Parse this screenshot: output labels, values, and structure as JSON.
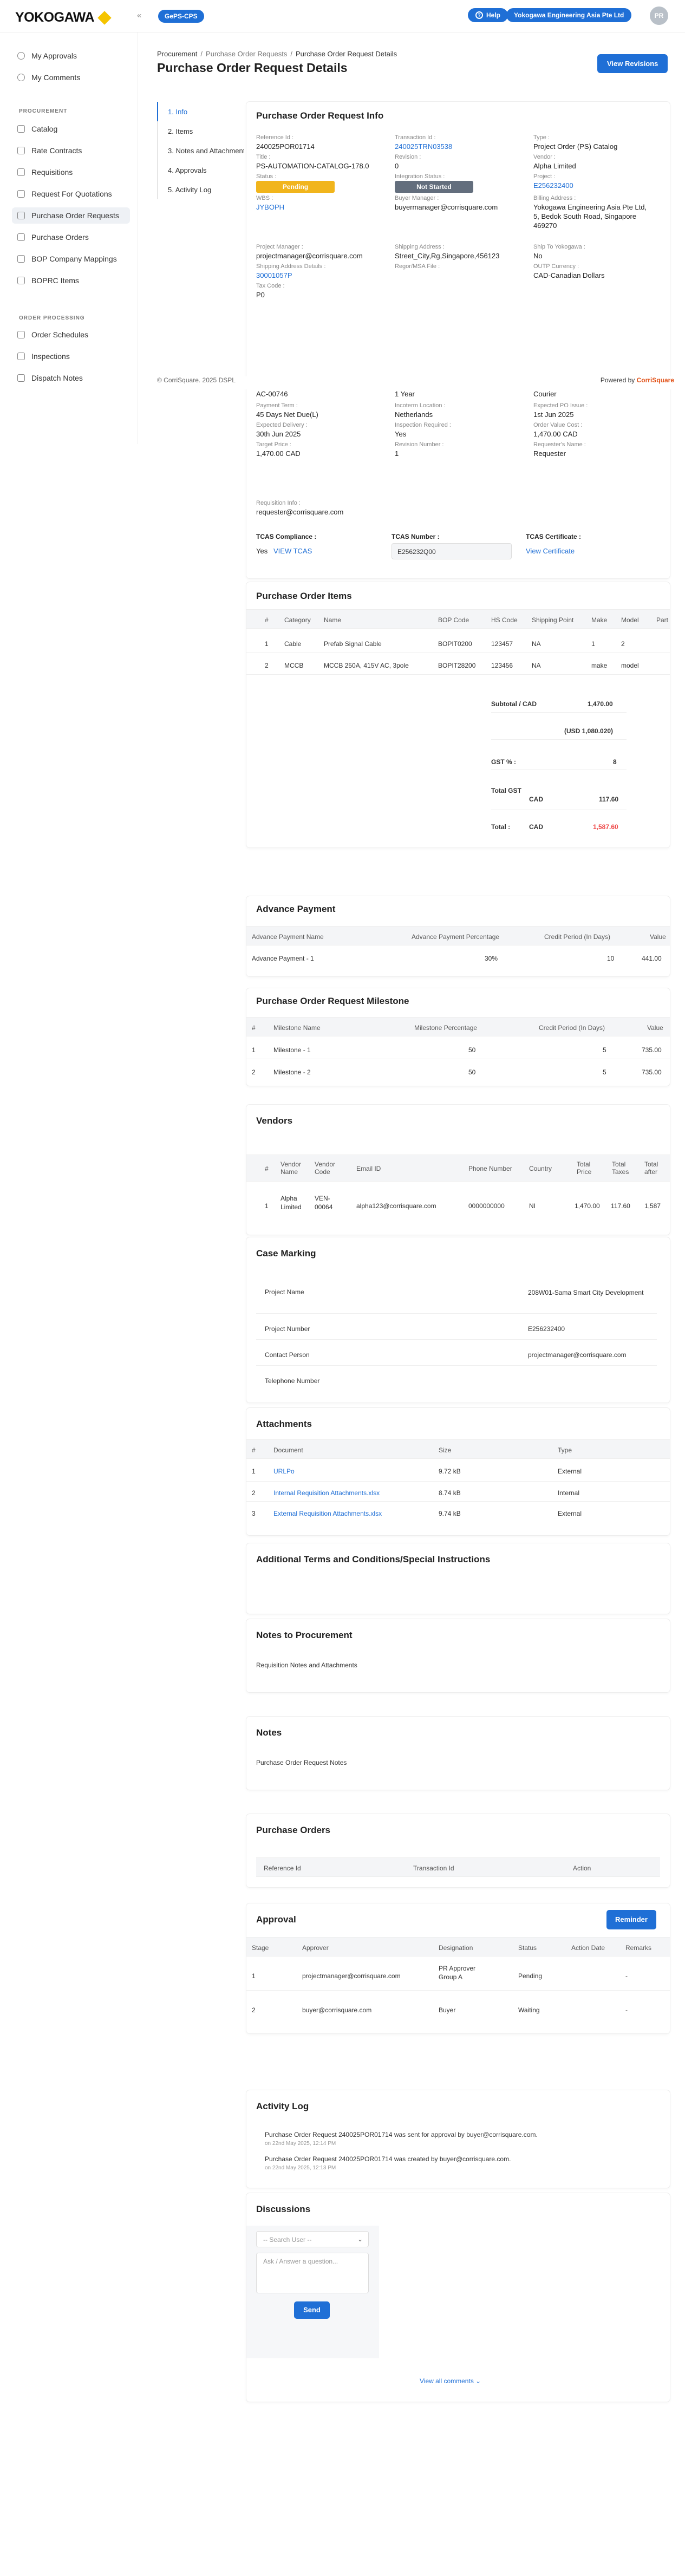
{
  "header": {
    "logo": "YOKOGAWA",
    "app_badge": "GePS-CPS",
    "help": "Help",
    "entity": "Yokogawa Engineering Asia Pte Ltd",
    "avatar": "PR"
  },
  "sidebar": {
    "top": [
      {
        "label": "My Approvals",
        "icon": "approvals-icon"
      },
      {
        "label": "My Comments",
        "icon": "comments-icon"
      }
    ],
    "section1": "PROCUREMENT",
    "procurement": [
      {
        "label": "Catalog"
      },
      {
        "label": "Rate Contracts"
      },
      {
        "label": "Requisitions"
      },
      {
        "label": "Request For Quotations"
      },
      {
        "label": "Purchase Order Requests"
      },
      {
        "label": "Purchase Orders"
      },
      {
        "label": "BOP Company Mappings"
      },
      {
        "label": "BOPRC Items"
      }
    ],
    "section2": "ORDER PROCESSING",
    "order": [
      {
        "label": "Order Schedules"
      },
      {
        "label": "Inspections"
      },
      {
        "label": "Dispatch Notes"
      }
    ]
  },
  "breadcrumb": [
    "Procurement",
    "/",
    "Purchase Order Requests",
    "/",
    "Purchase Order Request Details"
  ],
  "page_title": "Purchase Order Request Details",
  "view_revisions": "View Revisions",
  "nav": [
    "1. Info",
    "2. Items",
    "3. Notes and Attachments",
    "4. Approvals",
    "5. Activity Log"
  ],
  "footer": {
    "copyright": "© CorriSquare. 2025 DSPL",
    "powered": "Powered by",
    "brand": "CorriSquare"
  },
  "info": {
    "title": "Purchase Order Request Info",
    "fields": [
      {
        "label": "Reference Id :",
        "value": "240025POR01714"
      },
      {
        "label": "Transaction Id :",
        "value": "240025TRN03538",
        "link": true
      },
      {
        "label": "Type :",
        "value": "Project Order (PS) Catalog"
      },
      {
        "label": "Title :",
        "value": "PS-AUTOMATION-CATALOG-178.0"
      },
      {
        "label": "Revision :",
        "value": "0"
      },
      {
        "label": "Vendor :",
        "value": "Alpha Limited"
      },
      {
        "label": "WBS :",
        "value": "JYBOPH",
        "link": true
      },
      {
        "label": "Buyer Manager :",
        "value": "buyermanager@corrisquare.com"
      },
      {
        "label": "Billing Address :",
        "value": "Yokogawa Engineering Asia Pte Ltd, 5, Bedok South Road, Singapore 469270"
      },
      {
        "label": "Project Manager :",
        "value": "projectmanager@corrisquare.com"
      },
      {
        "label": "Shipping Address :",
        "value": "Street_City,Rg,Singapore,456123"
      },
      {
        "label": "Ship To Yokogawa :",
        "value": "No"
      },
      {
        "label": "Shipping Address Details :",
        "value": "30001057P",
        "link": true
      },
      {
        "label": "Regor/MSA File :",
        "value": ""
      },
      {
        "label": "OUTP Currency :",
        "value": "CAD-Canadian Dollars"
      },
      {
        "label": "Tax Code :",
        "value": "P0"
      },
      {
        "label": "INCOTERMS :",
        "value": "1 Year"
      },
      {
        "label": "Payment Term :",
        "value": "45 Days Net Due(L)"
      },
      {
        "label": "Incoterm Location :",
        "value": "Netherlands"
      },
      {
        "label": "Expected PO Issue :",
        "value": "1st Jun 2025"
      },
      {
        "label": "Expected Delivery :",
        "value": "30th Jun 2025"
      },
      {
        "label": "Inspection Required :",
        "value": "Yes"
      },
      {
        "label": "Order Value Cost :",
        "value": "1,470.00 CAD"
      },
      {
        "label": "Target Price :",
        "value": "1,470.00 CAD"
      },
      {
        "label": "Revision Number :",
        "value": "1"
      },
      {
        "label": "Requester's Name :",
        "value": "Requester"
      },
      {
        "label": "Requisition Info :",
        "value": "requester@corrisquare.com"
      }
    ],
    "status_label": "Status :",
    "status": "Pending",
    "integration_label": "Integration Status :",
    "integration": "Not Started",
    "project_label": "Project :",
    "project": "E256232400",
    "row_ac": "AC-00746",
    "row_courier": "Courier",
    "tcas_compliance_label": "TCAS Compliance :",
    "tcas_compliance": "Yes",
    "view_tcas": "VIEW TCAS",
    "tcas_number_label": "TCAS Number :",
    "tcas_number": "E256232Q00",
    "tcas_cert_label": "TCAS Certificate :",
    "view_cert": "View Certificate"
  },
  "items": {
    "title": "Purchase Order Items",
    "headers": [
      "#",
      "Category",
      "Name",
      "BOP Code",
      "HS Code",
      "Shipping Point",
      "Make",
      "Model",
      "Part"
    ],
    "rows": [
      [
        "1",
        "Cable",
        "Prefab Signal Cable",
        "BOPIT0200",
        "123457",
        "NA",
        "1",
        "2",
        ""
      ],
      [
        "2",
        "MCCB",
        "MCCB 250A, 415V AC, 3pole",
        "BOPIT28200",
        "123456",
        "NA",
        "make",
        "model",
        ""
      ]
    ],
    "subtotal_label": "Subtotal / CAD",
    "subtotal": "1,470.00",
    "usd": "(USD 1,080.020)",
    "gst_label": "GST % :",
    "gst": "8",
    "total_gst_label": "Total GST",
    "gst_cad": "CAD",
    "total_gst": "117.60",
    "total_label": "Total :",
    "total_cad": "CAD",
    "total": "1,587.60"
  },
  "advance": {
    "title": "Advance Payment",
    "headers": [
      "Advance Payment Name",
      "Advance Payment Percentage",
      "Credit Period (In Days)",
      "Value"
    ],
    "rows": [
      [
        "Advance Payment - 1",
        "30%",
        "10",
        "441.00"
      ]
    ]
  },
  "milestone": {
    "title": "Purchase Order Request Milestone",
    "headers": [
      "#",
      "Milestone Name",
      "Milestone Percentage",
      "Credit Period (In Days)",
      "Value"
    ],
    "rows": [
      [
        "1",
        "Milestone - 1",
        "50",
        "5",
        "735.00"
      ],
      [
        "2",
        "Milestone - 2",
        "50",
        "5",
        "735.00"
      ]
    ]
  },
  "vendors": {
    "title": "Vendors",
    "headers": [
      "#",
      "Vendor Name",
      "Vendor Code",
      "Email ID",
      "Phone Number",
      "Country",
      "Total Price",
      "Total Taxes",
      "Total after"
    ],
    "rows": [
      [
        "1",
        "Alpha Limited",
        "VEN-00064",
        "alpha123@corrisquare.com",
        "0000000000",
        "NI",
        "1,470.00",
        "117.60",
        "1,587"
      ]
    ]
  },
  "case": {
    "title": "Case Marking",
    "rows": [
      [
        "Project Name",
        "208W01-Sama Smart City Development"
      ],
      [
        "Project Number",
        "E256232400"
      ],
      [
        "Contact Person",
        "projectmanager@corrisquare.com"
      ],
      [
        "Telephone Number",
        ""
      ]
    ]
  },
  "attachments": {
    "title": "Attachments",
    "headers": [
      "#",
      "Document",
      "Size",
      "Type"
    ],
    "rows": [
      [
        "1",
        "URLPo",
        "9.72 kB",
        "External"
      ],
      [
        "2",
        "Internal Requisition Attachments.xlsx",
        "8.74 kB",
        "Internal"
      ],
      [
        "3",
        "External Requisition Attachments.xlsx",
        "9.74 kB",
        "External"
      ]
    ]
  },
  "terms": {
    "title": "Additional Terms and Conditions/Special Instructions"
  },
  "notes_proc": {
    "title": "Notes to Procurement",
    "text": "Requisition Notes and Attachments"
  },
  "notes": {
    "title": "Notes",
    "text": "Purchase Order Request Notes"
  },
  "purchase_orders": {
    "title": "Purchase Orders",
    "headers": [
      "Reference Id",
      "Transaction Id",
      "Action"
    ]
  },
  "approval": {
    "title": "Approval",
    "reminder": "Reminder",
    "headers": [
      "Stage",
      "Approver",
      "Designation",
      "Status",
      "Action Date",
      "Remarks"
    ],
    "rows": [
      [
        "1",
        "projectmanager@corrisquare.com",
        "PR Approver Group A",
        "Pending",
        "",
        "-"
      ],
      [
        "2",
        "buyer@corrisquare.com",
        "Buyer",
        "Waiting",
        "",
        "-"
      ]
    ]
  },
  "activity": {
    "title": "Activity Log",
    "items": [
      {
        "text": "Purchase Order Request 240025POR01714 was sent for approval by buyer@corrisquare.com.",
        "time": "on 22nd May 2025, 12:14 PM"
      },
      {
        "text": "Purchase Order Request 240025POR01714 was created by buyer@corrisquare.com.",
        "time": "on 22nd May 2025, 12:13 PM"
      }
    ]
  },
  "discussions": {
    "title": "Discussions",
    "select_placeholder": "-- Search User --",
    "textarea_placeholder": "Ask / Answer a question...",
    "send": "Send",
    "view_all": "View all comments"
  }
}
